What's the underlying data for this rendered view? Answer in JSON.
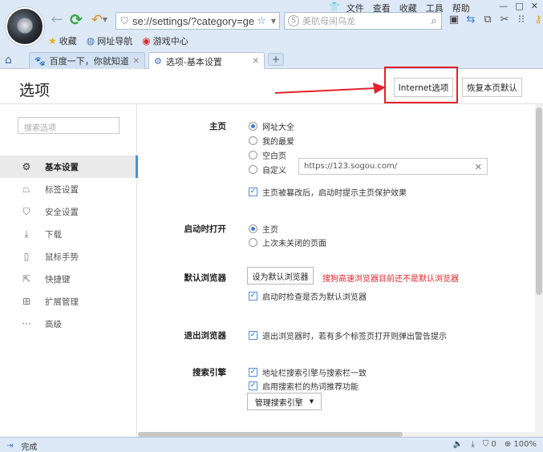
{
  "chrome": {
    "address": "se://settings/?category=gen",
    "search_placeholder": "美航母闹乌龙",
    "menu": [
      "文件",
      "查看",
      "收藏",
      "工具",
      "帮助"
    ],
    "window_controls": [
      "—",
      "□",
      "✕"
    ],
    "favorites": [
      {
        "label": "收藏",
        "icon": "star-icon"
      },
      {
        "label": "网址导航",
        "icon": "globe-icon"
      },
      {
        "label": "游戏中心",
        "icon": "game-icon"
      }
    ],
    "tabs": [
      {
        "label": "百度一下，你就知道",
        "icon": "paw-icon",
        "active": false
      },
      {
        "label": "选项-基本设置",
        "icon": "gear-icon",
        "active": true
      }
    ],
    "new_tab": "+"
  },
  "page": {
    "title": "选项",
    "internet_options": "Internet选项",
    "restore_defaults": "恢复本页默认",
    "sidebar_search_placeholder": "搜索选项",
    "sidebar": [
      {
        "label": "基本设置",
        "icon": "gear-icon",
        "active": true
      },
      {
        "label": "标签设置",
        "icon": "tab-icon"
      },
      {
        "label": "安全设置",
        "icon": "shield-icon"
      },
      {
        "label": "下载",
        "icon": "download-icon"
      },
      {
        "label": "鼠标手势",
        "icon": "mouse-icon"
      },
      {
        "label": "快捷键",
        "icon": "shortcut-icon"
      },
      {
        "label": "扩展管理",
        "icon": "extension-icon"
      },
      {
        "label": "高级",
        "icon": "more-icon"
      }
    ],
    "homepage": {
      "label": "主页",
      "options": [
        "网址大全",
        "我的最爱",
        "空白页",
        "自定义"
      ],
      "selected": "网址大全",
      "custom_url": "https://123.sogou.com/",
      "protect_check": "主页被篡改后，启动时提示主页保护效果",
      "protect_checked": true
    },
    "startup": {
      "label": "启动时打开",
      "options": [
        "主页",
        "上次未关闭的页面"
      ],
      "selected": "主页"
    },
    "default_browser": {
      "label": "默认浏览器",
      "button": "设为默认浏览器",
      "warning": "搜狗高速浏览器目前还不是默认浏览器",
      "check": "启动时检查是否为默认浏览器",
      "checked": true
    },
    "exit_browser": {
      "label": "退出浏览器",
      "check": "退出浏览器时，若有多个标签页打开则弹出警告提示",
      "checked": true
    },
    "search_engine": {
      "label": "搜索引擎",
      "checks": [
        "地址栏搜索引擎与搜索栏一致",
        "启用搜索栏的热词推荐功能"
      ],
      "manage_button": "管理搜索引擎"
    }
  },
  "status": {
    "text": "完成",
    "shield_count": "0",
    "zoom": "100%"
  },
  "colors": {
    "accent": "#3a7bd5",
    "highlight": "#e3232b",
    "chrome": "#dde9f6"
  }
}
